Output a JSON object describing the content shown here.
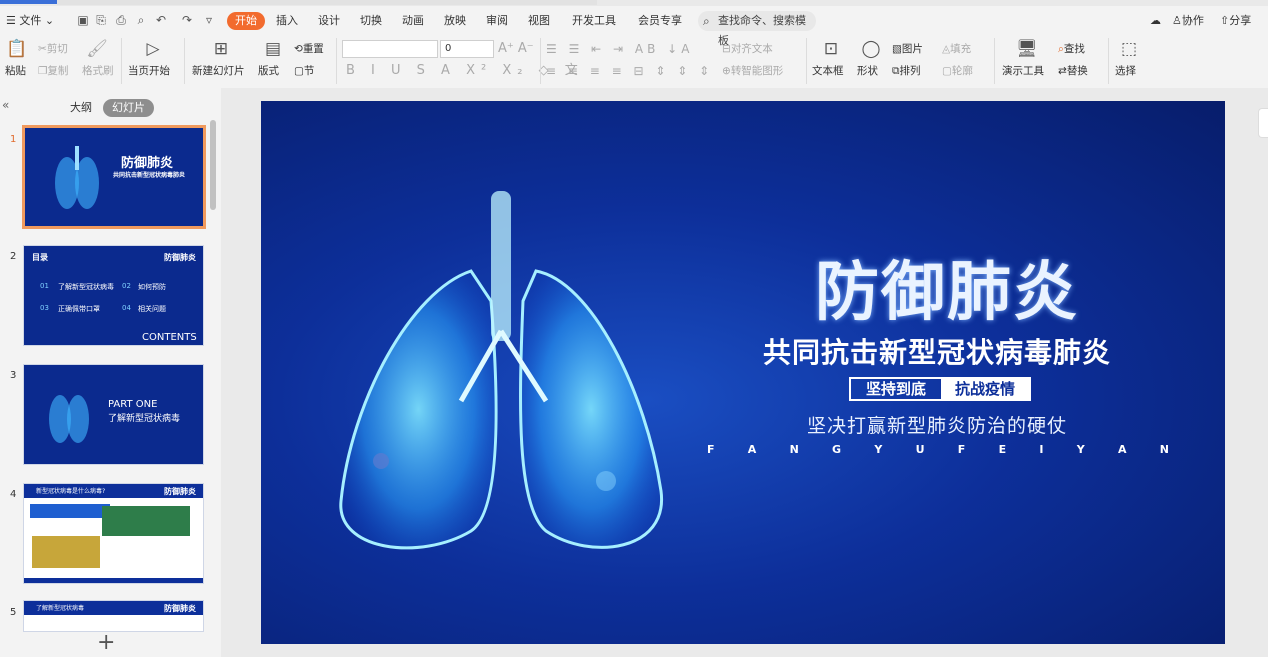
{
  "menu": {
    "file": "文件",
    "tabs": [
      "开始",
      "插入",
      "设计",
      "切换",
      "动画",
      "放映",
      "审阅",
      "视图",
      "开发工具",
      "会员专享"
    ],
    "search_placeholder": "查找命令、搜索模板",
    "right": {
      "collab": "协作",
      "share": "分享"
    }
  },
  "ribbon": {
    "paste": "粘贴",
    "cut": "剪切",
    "copy": "复制",
    "format_painter": "格式刷",
    "from_current": "当页开始",
    "new_slide": "新建幻灯片",
    "layout": "版式",
    "section": "节",
    "reset": "重置",
    "font_size": "0",
    "align_text": "对齐文本",
    "smart_art": "转智能图形",
    "textbox": "文本框",
    "shape": "形状",
    "picture": "图片",
    "fill": "填充",
    "arrange": "排列",
    "outline": "轮廓",
    "present_tools": "演示工具",
    "find": "查找",
    "replace": "替换",
    "select": "选择"
  },
  "panel": {
    "outline_tab": "大纲",
    "slides_tab": "幻灯片",
    "slide_numbers": [
      "1",
      "2",
      "3",
      "4",
      "5"
    ]
  },
  "thumbs": {
    "s1": {
      "title": "防御肺炎",
      "sub": "共同抗击新型冠状病毒肺炎"
    },
    "s2": {
      "head": "目录",
      "brand": "防御肺炎",
      "items": [
        "了解新型冠状病毒",
        "如何预防",
        "正确佩带口罩",
        "相关问题"
      ],
      "nums": [
        "01",
        "02",
        "03",
        "04"
      ],
      "footer": "CONTENTS"
    },
    "s3": {
      "part": "PART ONE",
      "title": "了解新型冠状病毒"
    },
    "s4": {
      "head": "新型冠状病毒是什么病毒?",
      "brand": "防御肺炎"
    },
    "s5": {
      "head": "了解新型冠状病毒",
      "brand": "防御肺炎"
    }
  },
  "slide": {
    "title": "防御肺炎",
    "subtitle": "共同抗击新型冠状病毒肺炎",
    "tag_left": "坚持到底",
    "tag_right": "抗战疫情",
    "description": "坚决打赢新型肺炎防治的硬仗",
    "letters": [
      "F",
      "A",
      "N",
      "G",
      "Y",
      "U",
      "F",
      "E",
      "I",
      "Y",
      "A",
      "N"
    ]
  },
  "colors": {
    "accent": "#f26b2e",
    "slide_bg": "#0d2f9a",
    "selection": "#f09a5e"
  }
}
